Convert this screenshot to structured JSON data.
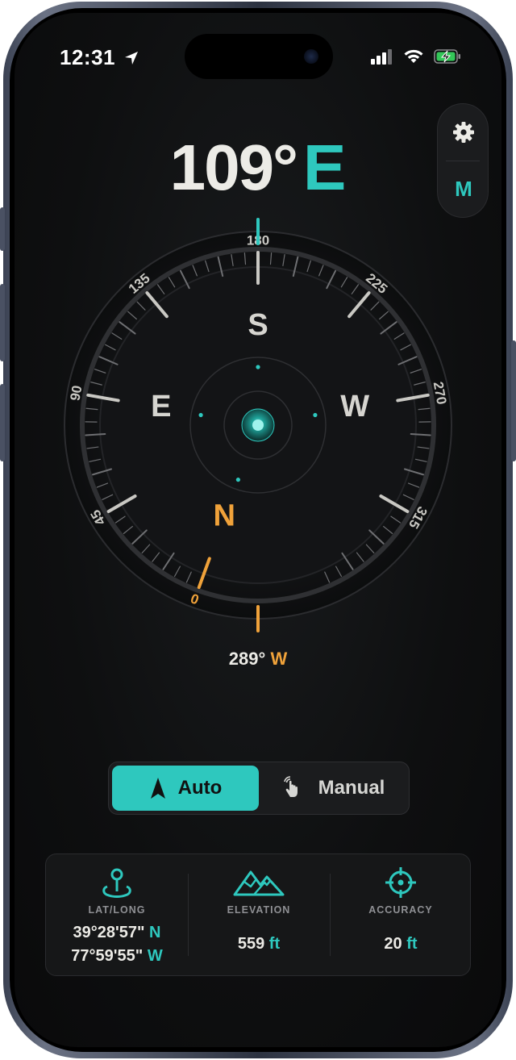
{
  "status_bar": {
    "time": "12:31",
    "icons": [
      "location-arrow-icon",
      "signal-bars-icon",
      "wifi-icon",
      "battery-charging-icon"
    ]
  },
  "heading": {
    "degrees": "109°",
    "direction": "E"
  },
  "side_panel": {
    "settings_icon": "gear-icon",
    "mode_label": "M"
  },
  "compass": {
    "degree_labels": [
      "0",
      "45",
      "90",
      "135",
      "180",
      "225",
      "270",
      "315"
    ],
    "cardinal_labels": {
      "north": "N",
      "east": "E",
      "south": "S",
      "west": "W"
    },
    "colors": {
      "accent": "#2ec8be",
      "north": "#f0a23a"
    }
  },
  "back_bearing": {
    "degrees": "289°",
    "direction": "W"
  },
  "mode_toggle": {
    "auto_label": "Auto",
    "manual_label": "Manual",
    "selected": "Auto"
  },
  "info": {
    "latlong": {
      "label": "LAT/LONG",
      "lat": "39°28'57\"",
      "lat_dir": "N",
      "long": "77°59'55\"",
      "long_dir": "W"
    },
    "elevation": {
      "label": "ELEVATION",
      "value": "559",
      "unit": "ft"
    },
    "accuracy": {
      "label": "ACCURACY",
      "value": "20",
      "unit": "ft"
    }
  }
}
